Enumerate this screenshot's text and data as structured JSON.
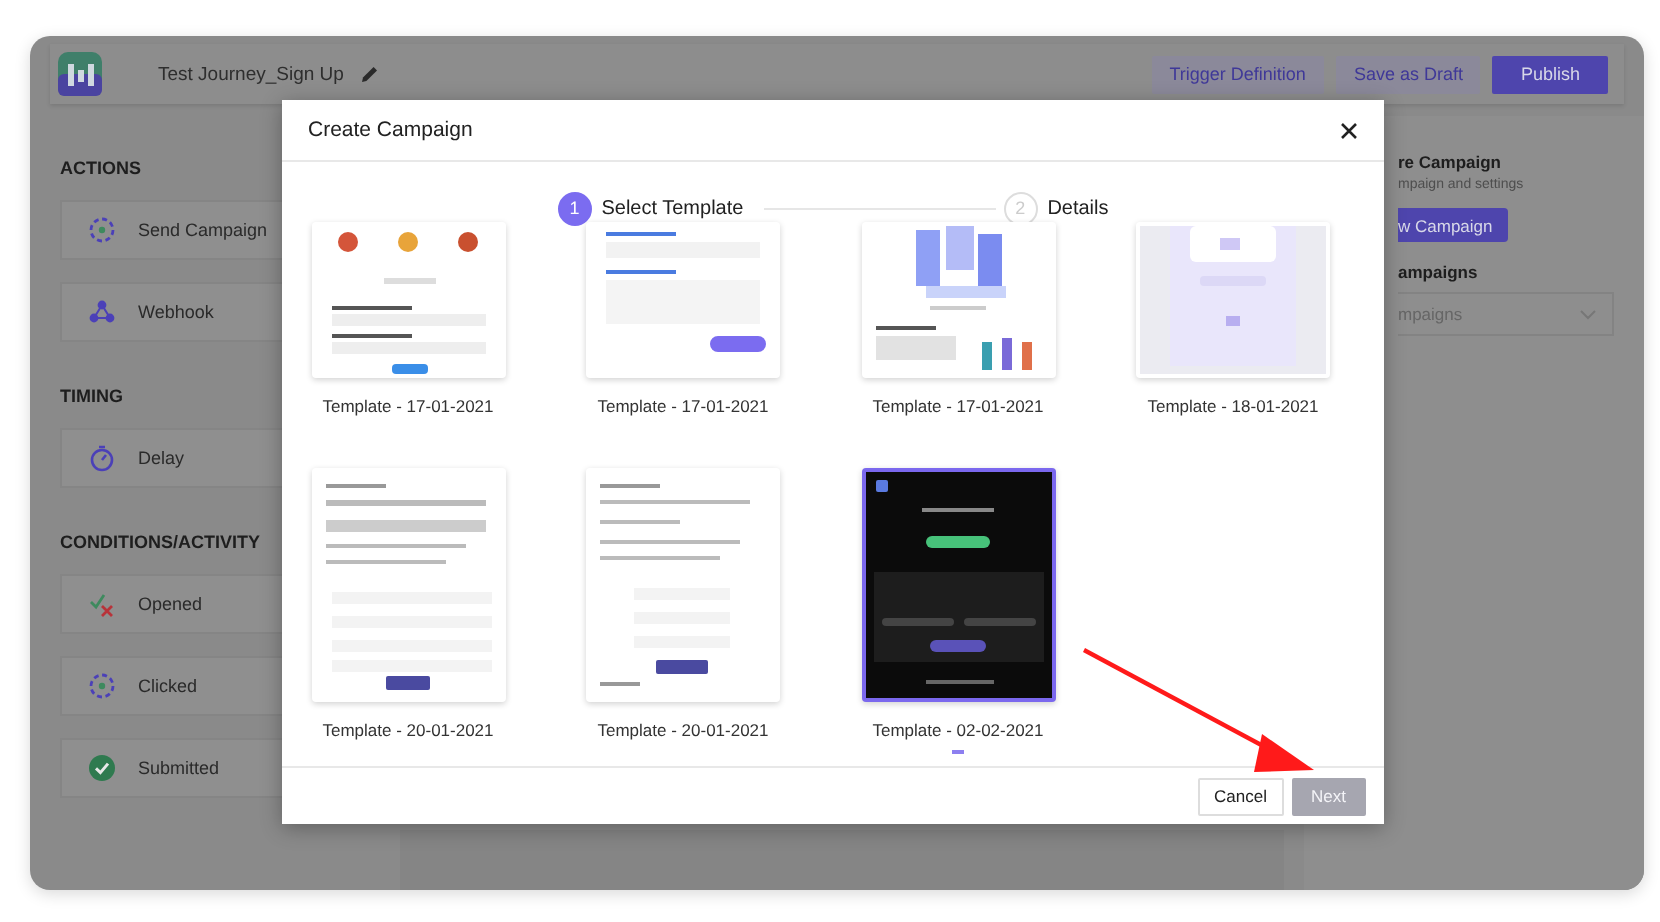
{
  "app": {
    "title": "Test Journey_Sign Up",
    "buttons": [
      {
        "label": "Trigger Definition",
        "kind": "secondary"
      },
      {
        "label": "Save as Draft",
        "kind": "secondary"
      },
      {
        "label": "Publish",
        "kind": "primary"
      }
    ]
  },
  "sidebar": {
    "sections": [
      {
        "heading": "ACTIONS",
        "items": [
          "Send Campaign",
          "Webhook"
        ]
      },
      {
        "heading": "TIMING",
        "items": [
          "Delay"
        ]
      },
      {
        "heading": "CONDITIONS/ACTIVITY",
        "items": [
          "Opened",
          "Clicked",
          "Submitted"
        ]
      }
    ]
  },
  "right_panel": {
    "title": "re Campaign",
    "subtitle": "mpaign and settings",
    "button": "w Campaign",
    "field_label": "ampaigns",
    "dropdown": {
      "placeholder": "mpaigns"
    }
  },
  "modal": {
    "title": "Create Campaign",
    "steps": [
      {
        "number": "1",
        "label": "Select Template",
        "selected": true
      },
      {
        "number": "2",
        "label": "Details",
        "selected": false
      }
    ],
    "templates": [
      {
        "label": "Template - 17-01-2021",
        "selected": false
      },
      {
        "label": "Template - 17-01-2021",
        "selected": false
      },
      {
        "label": "Template - 17-01-2021",
        "selected": false
      },
      {
        "label": "Template - 18-01-2021",
        "selected": false
      },
      {
        "label": "Template - 20-01-2021",
        "selected": false
      },
      {
        "label": "Template - 20-01-2021",
        "selected": false
      },
      {
        "label": "Template - 02-02-2021",
        "selected": true
      }
    ],
    "buttons": [
      {
        "label": "Cancel",
        "disabled": false
      },
      {
        "label": "Next",
        "disabled": true
      }
    ]
  }
}
